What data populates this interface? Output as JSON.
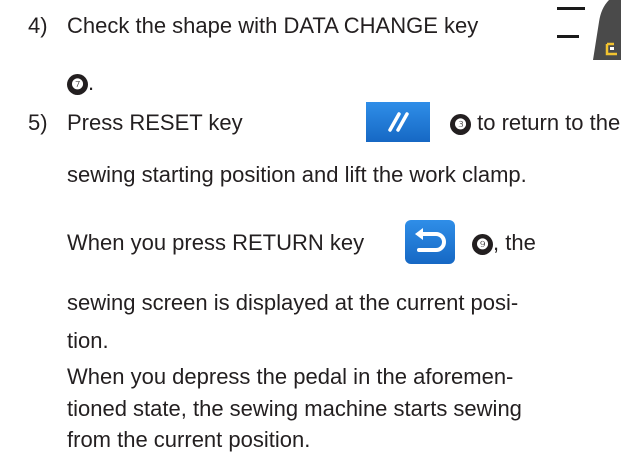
{
  "steps": [
    {
      "number": "4)",
      "text_before_key": "Check the shape with DATA CHANGE key",
      "key_icon": "data-change-key-icon",
      "ref_marker": "❼",
      "ref_suffix": "."
    },
    {
      "number": "5)",
      "text_before_key": "Press RESET key",
      "key_icon": "reset-key-icon",
      "ref_marker": "❸",
      "text_after_key": "to return to the",
      "continuation": "sewing starting position and lift the work clamp."
    }
  ],
  "note_return": {
    "text_before_key": "When you press RETURN key",
    "key_icon": "return-key-icon",
    "ref_marker": "❾",
    "text_after_key": ", the",
    "line2": "sewing screen is displayed at the current posi-",
    "line3": "tion."
  },
  "note_pedal": {
    "line1": "When you depress the pedal in the aforemen-",
    "line2": "tioned state, the sewing machine starts sewing",
    "line3": "from the current position."
  },
  "colors": {
    "text": "#231f20",
    "key_blue": "#1f7bd8",
    "key_dark": "#4a4a4a"
  }
}
